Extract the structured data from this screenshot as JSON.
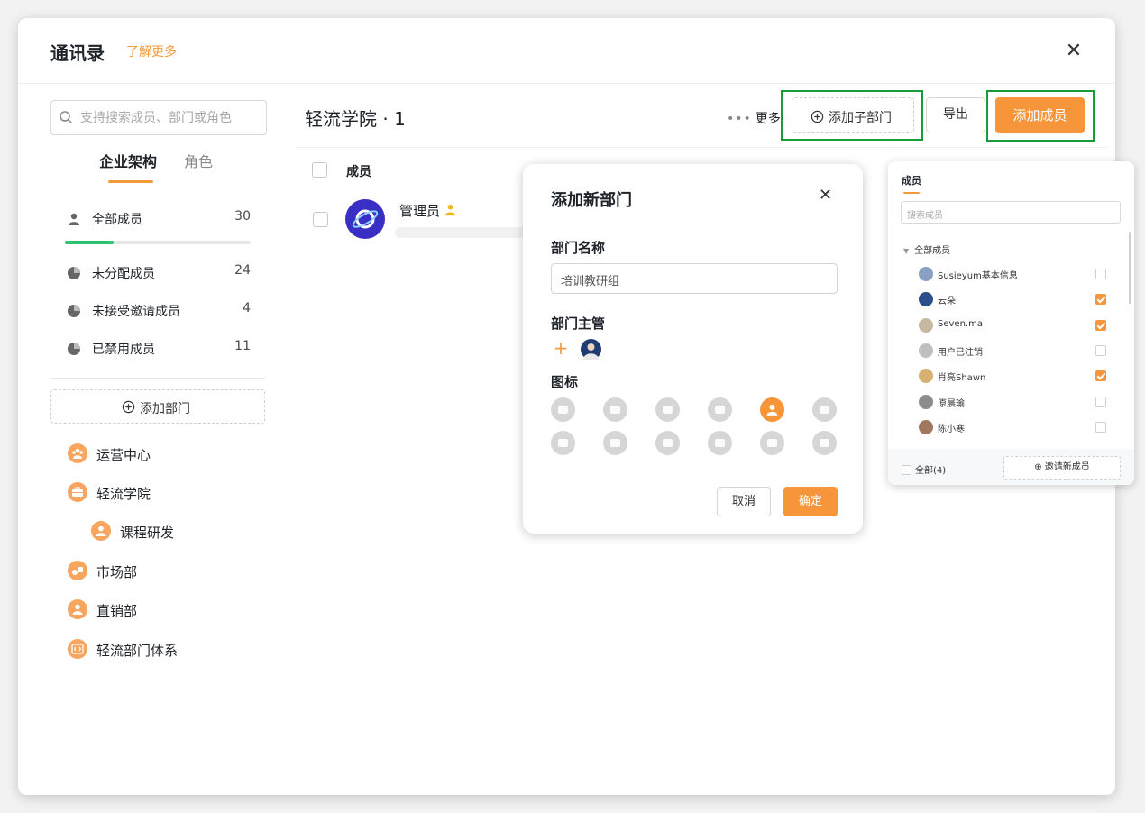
{
  "header": {
    "title": "通讯录",
    "learn_more": "了解更多"
  },
  "search": {
    "placeholder": "支持搜索成员、部门或角色"
  },
  "tabs": {
    "org": "企业架构",
    "roles": "角色"
  },
  "stats": [
    {
      "label": "全部成员",
      "count": "30",
      "icon": "user-icon"
    },
    {
      "label": "未分配成员",
      "count": "24",
      "icon": "pie-icon"
    },
    {
      "label": "未接受邀请成员",
      "count": "4",
      "icon": "pie-icon"
    },
    {
      "label": "已禁用成员",
      "count": "11",
      "icon": "pie-icon"
    }
  ],
  "stat_progress": 0.26,
  "sidebar": {
    "add_dept": "添加部门"
  },
  "departments": [
    {
      "label": "运营中心",
      "icon": "team-icon"
    },
    {
      "label": "轻流学院",
      "icon": "briefcase-icon"
    },
    {
      "label": "课程研发",
      "icon": "person-icon"
    },
    {
      "label": "市场部",
      "icon": "chart-icon"
    },
    {
      "label": "直销部",
      "icon": "person-icon"
    },
    {
      "label": "轻流部门体系",
      "icon": "code-icon"
    }
  ],
  "main": {
    "dept_title": "轻流学院 · 1",
    "more": "更多",
    "add_sub_dept": "添加子部门",
    "export": "导出",
    "add_member": "添加成员",
    "col_member": "成员",
    "row_name": "管理员"
  },
  "modal": {
    "title": "添加新部门",
    "name_label": "部门名称",
    "name_value": "培训教研组",
    "manager_label": "部门主管",
    "icon_label": "图标",
    "cancel": "取消",
    "ok": "确定"
  },
  "picker": {
    "tab": "成员",
    "search_placeholder": "搜索成员",
    "root": "全部成员",
    "members": [
      {
        "name": "Susieyum基本信息",
        "checked": false
      },
      {
        "name": "云朵",
        "checked": true
      },
      {
        "name": "Seven.ma",
        "checked": true
      },
      {
        "name": "用户已注销",
        "checked": false
      },
      {
        "name": "肖亮Shawn",
        "checked": true
      },
      {
        "name": "原晨瑜",
        "checked": false
      },
      {
        "name": "陈小寒",
        "checked": false
      }
    ],
    "select_all": "全部(4)",
    "invite": "邀请新成员"
  },
  "colors": {
    "accent": "#f7953b",
    "highlight": "#1a9c3a",
    "progress": "#2ec36c"
  }
}
